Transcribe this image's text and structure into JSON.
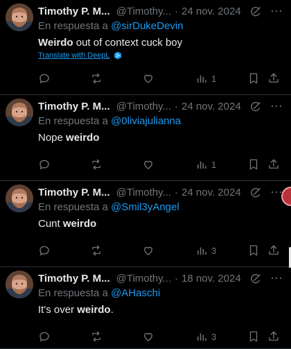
{
  "posts": [
    {
      "name": "Timothy P. M...",
      "handle": "@Timothy...",
      "sep": "·",
      "date": "24 nov. 2024",
      "reply_prefix": "En respuesta a",
      "reply_to": "@sirDukeDevin",
      "text_parts": [
        {
          "t": "Weirdo",
          "b": true
        },
        {
          "t": " out of context cuck boy",
          "b": false
        }
      ],
      "translate": "Translate with DeepL",
      "views": "1"
    },
    {
      "name": "Timothy P. M...",
      "handle": "@Timothy...",
      "sep": "·",
      "date": "24 nov. 2024",
      "reply_prefix": "En respuesta a",
      "reply_to": "@0liviajulianna",
      "text_parts": [
        {
          "t": "Nope ",
          "b": false
        },
        {
          "t": "weirdo",
          "b": true
        }
      ],
      "translate": "",
      "views": "1"
    },
    {
      "name": "Timothy P. M...",
      "handle": "@Timothy...",
      "sep": "·",
      "date": "24 nov. 2024",
      "reply_prefix": "En respuesta a",
      "reply_to": "@Smil3yAngel",
      "text_parts": [
        {
          "t": "Cunt ",
          "b": false
        },
        {
          "t": "weirdo",
          "b": true
        }
      ],
      "translate": "",
      "views": "3"
    },
    {
      "name": "Timothy P. M...",
      "handle": "@Timothy...",
      "sep": "·",
      "date": "18 nov. 2024",
      "reply_prefix": "En respuesta a",
      "reply_to": "@AHaschi",
      "text_parts": [
        {
          "t": "It's over ",
          "b": false
        },
        {
          "t": "weirdo",
          "b": true
        },
        {
          "t": ".",
          "b": false
        }
      ],
      "translate": "",
      "views": "3"
    }
  ],
  "icons": {
    "reply": "reply-icon",
    "repost": "repost-icon",
    "like": "like-icon",
    "views": "views-icon",
    "bookmark": "bookmark-icon",
    "share": "share-icon",
    "grok": "grok-icon",
    "more": "more-icon"
  },
  "colors": {
    "background": "#000000",
    "text": "#e7e9ea",
    "muted": "#71767b",
    "link": "#1d9bf0",
    "divider": "#2f3336"
  }
}
